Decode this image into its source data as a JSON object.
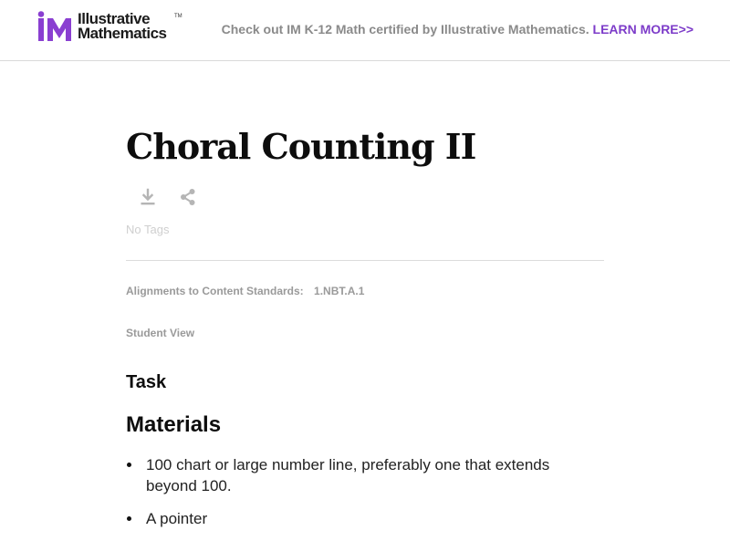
{
  "header": {
    "logo_line1": "Illustrative",
    "logo_line2": "Mathematics",
    "logo_tm": "TM",
    "promo_text": "Check out IM K-12 Math certified by Illustrative Mathematics.",
    "promo_link": "LEARN MORE>>"
  },
  "colors": {
    "brand_purple": "#7d3cc9",
    "muted_text": "#9a9a9a"
  },
  "page": {
    "title": "Choral Counting II",
    "actions": [
      "download-icon",
      "share-icon"
    ],
    "tags_text": "No Tags",
    "alignments_label": "Alignments to Content Standards:",
    "alignments_standard": "1.NBT.A.1",
    "student_view": "Student View",
    "task_heading": "Task",
    "materials_heading": "Materials",
    "materials": [
      "100 chart or large number line, preferably one that extends beyond 100.",
      "A pointer"
    ]
  }
}
